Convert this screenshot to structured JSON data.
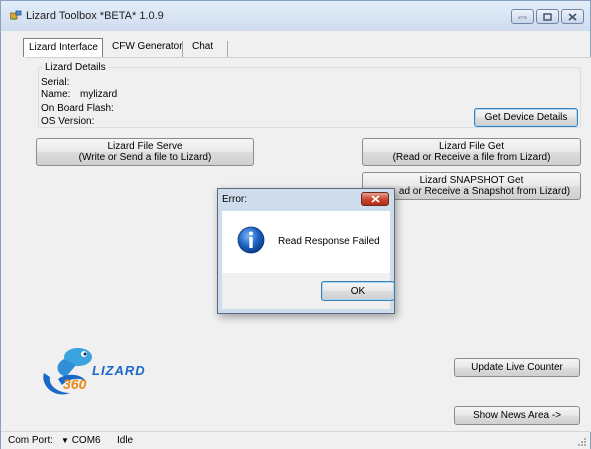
{
  "window": {
    "title": "Lizard Toolbox *BETA* 1.0.9",
    "icon": "app-icon"
  },
  "tabs": [
    {
      "label": "Lizard Interface",
      "active": true
    },
    {
      "label": "CFW Generator",
      "active": false
    },
    {
      "label": "Chat",
      "active": false
    }
  ],
  "details": {
    "group_title": "Lizard Details",
    "serial_label": "Serial:",
    "name_label": "Name:",
    "name_value": "mylizard",
    "flash_label": "On Board Flash:",
    "os_label": "OS Version:",
    "get_details_button": "Get Device Details"
  },
  "buttons": {
    "file_serve_line1": "Lizard File Serve",
    "file_serve_line2": "(Write or Send a file to Lizard)",
    "file_get_line1": "Lizard File Get",
    "file_get_line2": "(Read or Receive a file from Lizard)",
    "snapshot_line1": "Lizard SNAPSHOT Get",
    "snapshot_line2": "ad or Receive a Snapshot from Lizard)",
    "update_counter": "Update Live Counter",
    "news_area": "Show News Area ->"
  },
  "logo": {
    "text": "LIZARD",
    "badge": "360"
  },
  "status": {
    "port_label": "Com Port:",
    "port_value": "COM6",
    "state": "Idle"
  },
  "dialog": {
    "title": "Error:",
    "message": "Read Response Failed",
    "ok_label": "OK",
    "icon": "info-icon"
  },
  "colors": {
    "titlebar": "#cfdcee",
    "dialog_close": "#c6442c",
    "info_blue": "#1c62c4",
    "logo_blue": "#1a68c8",
    "logo_orange": "#e88a1a"
  }
}
